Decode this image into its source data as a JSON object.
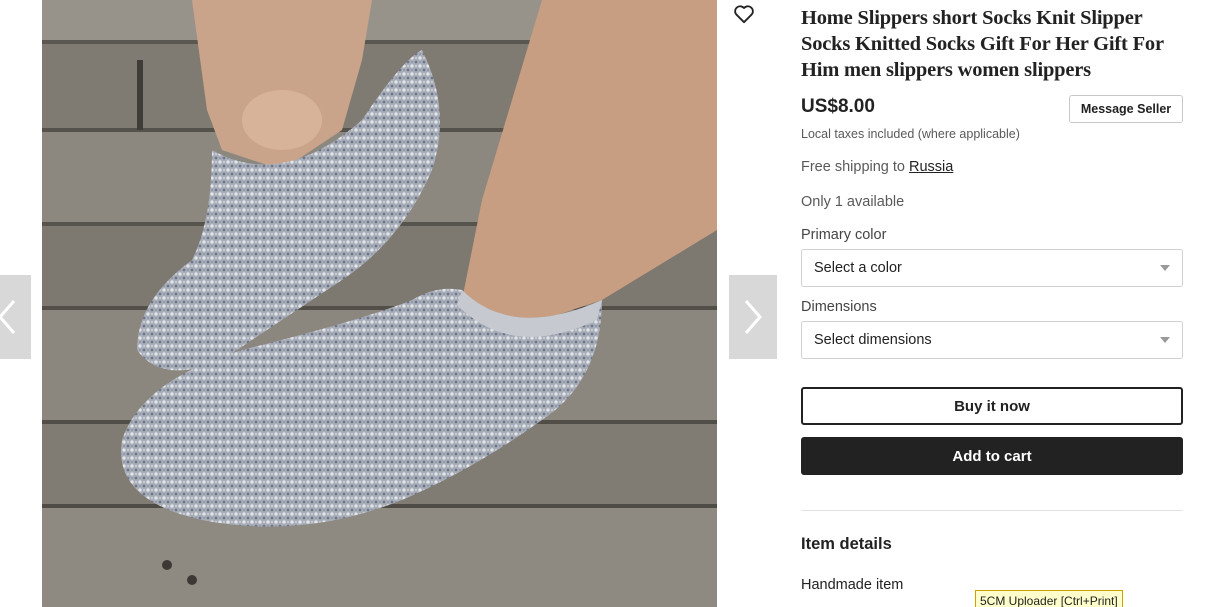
{
  "product": {
    "title": "Home Slippers short Socks Knit Slipper Socks Knitted Socks Gift For Her Gift For Him men slippers women slippers",
    "price": "US$8.00",
    "tax_note": "Local taxes included (where applicable)",
    "shipping_prefix": "Free shipping to ",
    "shipping_country": "Russia",
    "availability": "Only 1 available"
  },
  "actions": {
    "message_seller": "Message Seller",
    "buy_now": "Buy it now",
    "add_to_cart": "Add to cart"
  },
  "options": {
    "primary_color": {
      "label": "Primary color",
      "selected": "Select a color"
    },
    "dimensions": {
      "label": "Dimensions",
      "selected": "Select dimensions"
    }
  },
  "details": {
    "heading": "Item details",
    "handmade": "Handmade item"
  },
  "gallery": {
    "prev_icon": "chevron-left-icon",
    "next_icon": "chevron-right-icon",
    "favorite_icon": "heart-outline-icon"
  },
  "overlay": {
    "tooltip": "5CM Uploader [Ctrl+Print]"
  },
  "colors": {
    "primary_text": "#222222",
    "secondary_text": "#595959",
    "cart_button_bg": "#222222",
    "nav_arrow_bg": "#d8d8d8",
    "tooltip_bg": "#ffffcc"
  }
}
